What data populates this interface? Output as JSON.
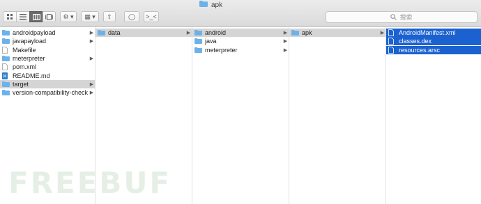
{
  "window": {
    "title": "apk"
  },
  "toolbar": {
    "view_buttons": [
      "icon-view",
      "list-view",
      "column-view",
      "gallery-view"
    ],
    "action_label": "⚙ ▾",
    "arrange_label": "▦ ▾",
    "share_label": "⇧",
    "tag_label": "◯",
    "terminal_label": ">_<"
  },
  "search": {
    "placeholder": "搜索"
  },
  "columns": [
    {
      "items": [
        {
          "name": "androidpayload",
          "type": "folder",
          "chevron": true
        },
        {
          "name": "javapayload",
          "type": "folder",
          "chevron": true
        },
        {
          "name": "Makefile",
          "type": "file",
          "chevron": false
        },
        {
          "name": "meterpreter",
          "type": "folder",
          "chevron": true
        },
        {
          "name": "pom.xml",
          "type": "file",
          "chevron": false
        },
        {
          "name": "README.md",
          "type": "md",
          "chevron": false
        },
        {
          "name": "target",
          "type": "folder",
          "chevron": true,
          "selected": "grey"
        },
        {
          "name": "version-compatibility-check",
          "type": "folder",
          "chevron": true
        }
      ]
    },
    {
      "items": [
        {
          "name": "data",
          "type": "folder",
          "chevron": true,
          "selected": "grey"
        }
      ]
    },
    {
      "items": [
        {
          "name": "android",
          "type": "folder",
          "chevron": true,
          "selected": "grey"
        },
        {
          "name": "java",
          "type": "folder",
          "chevron": true
        },
        {
          "name": "meterpreter",
          "type": "folder",
          "chevron": true
        }
      ]
    },
    {
      "items": [
        {
          "name": "apk",
          "type": "folder",
          "chevron": true,
          "selected": "grey"
        }
      ]
    },
    {
      "items": [
        {
          "name": "AndroidManifest.xml",
          "type": "file",
          "chevron": false,
          "selected": "blue"
        },
        {
          "name": "classes.dex",
          "type": "file",
          "chevron": false,
          "selected": "blue"
        },
        {
          "name": "resources.arsc",
          "type": "file",
          "chevron": false,
          "selected": "blue"
        }
      ]
    }
  ],
  "watermark": "FREEBUF",
  "colors": {
    "folder": "#6cb2ea",
    "selection_blue": "#1b62d0",
    "selection_grey": "#d5d5d5"
  }
}
